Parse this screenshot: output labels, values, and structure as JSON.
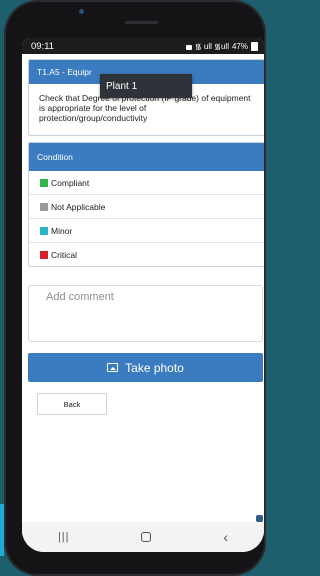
{
  "statusbar": {
    "time": "09:11",
    "signal": "᯾ ull ᯾ull",
    "battery": "47%"
  },
  "tooltip": {
    "text": "Plant 1"
  },
  "question": {
    "header": "T1.A5 - Equipr",
    "text": "Check that Degree of protection (IP grade) of equipment is appropriate for the level of protection/group/conductivity"
  },
  "condition": {
    "header": "Condition",
    "options": [
      {
        "label": "Compliant",
        "color": "#2eb84b"
      },
      {
        "label": "Not Applicable",
        "color": "#9a9a9a"
      },
      {
        "label": "Minor",
        "color": "#2bb3c6"
      },
      {
        "label": "Critical",
        "color": "#d61f26"
      }
    ]
  },
  "comment": {
    "placeholder": "Add comment"
  },
  "photo_button": {
    "label": "Take photo"
  },
  "back_button": {
    "label": "Back"
  },
  "colors": {
    "accent": "#3b7bc0"
  }
}
